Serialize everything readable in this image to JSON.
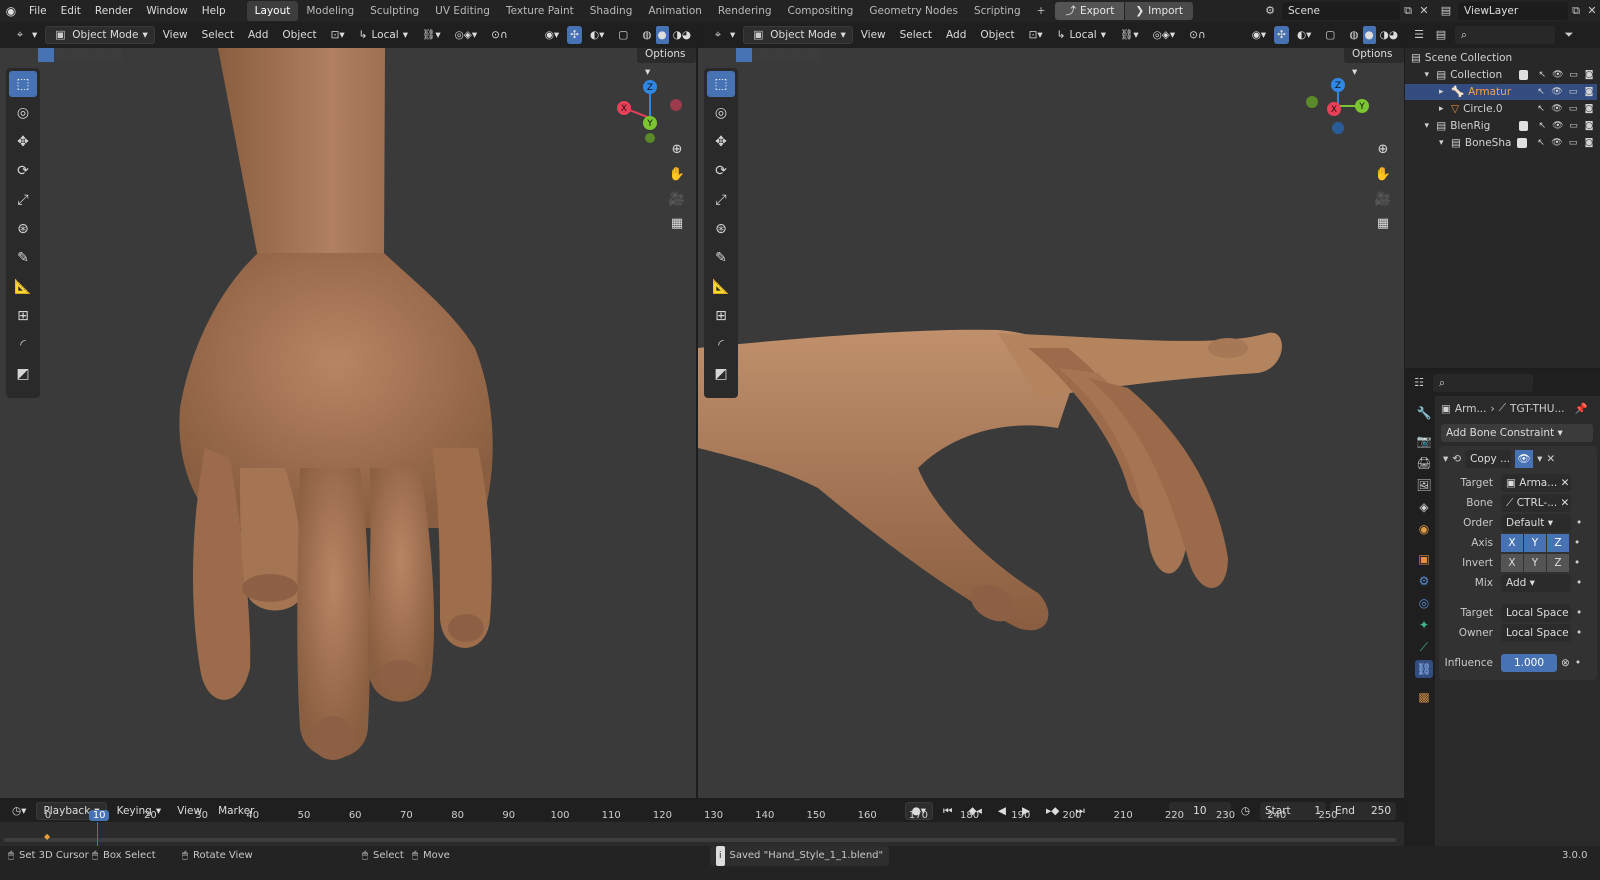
{
  "menu": [
    "File",
    "Edit",
    "Render",
    "Window",
    "Help"
  ],
  "workspaces": [
    "Layout",
    "Modeling",
    "Sculpting",
    "UV Editing",
    "Texture Paint",
    "Shading",
    "Animation",
    "Rendering",
    "Compositing",
    "Geometry Nodes",
    "Scripting"
  ],
  "add_tab": "+",
  "export_label": "Export",
  "import_label": "Import",
  "scene": "Scene",
  "view_layer": "ViewLayer",
  "viewport_header": {
    "mode": "Object Mode",
    "view": "View",
    "select": "Select",
    "add": "Add",
    "object": "Object",
    "pivot": "Local"
  },
  "options_label": "Options",
  "gizmo": {
    "x": "X",
    "y": "Y",
    "z": "Z",
    "x_color": "#e84058",
    "y_color": "#7ac530",
    "z_color": "#2f87e6"
  },
  "outliner": {
    "rows": [
      {
        "label": "Scene Collection",
        "indent": 0,
        "type": "scene"
      },
      {
        "label": "Collection",
        "indent": 1,
        "type": "coll"
      },
      {
        "label": "Armatur",
        "indent": 2,
        "type": "armature",
        "selected": true
      },
      {
        "label": "Circle.0",
        "indent": 2,
        "type": "curve"
      },
      {
        "label": "BlenRig",
        "indent": 1,
        "type": "coll"
      },
      {
        "label": "BoneSha",
        "indent": 2,
        "type": "coll"
      }
    ]
  },
  "properties": {
    "breadcrumb_obj": "Arm...",
    "breadcrumb_bone": "TGT-THU...",
    "add_constraint": "Add Bone Constraint",
    "constraint_name": "Copy ...",
    "target_label": "Target",
    "target_value": "Arma...",
    "bone_label": "Bone",
    "bone_value": "CTRL-...",
    "order_label": "Order",
    "order_value": "Default",
    "axis_label": "Axis",
    "invert_label": "Invert",
    "mix_label": "Mix",
    "mix_value": "Add",
    "target_space_label": "Target",
    "target_space": "Local Space",
    "owner_space_label": "Owner",
    "owner_space": "Local Space",
    "influence_label": "Influence",
    "influence": "1.000",
    "axes": [
      "X",
      "Y",
      "Z"
    ]
  },
  "timeline": {
    "menus": [
      "Playback",
      "Keying",
      "View",
      "Marker"
    ],
    "current_frame": "10",
    "start_label": "Start",
    "start": "1",
    "end_label": "End",
    "end": "250",
    "ticks": [
      "0",
      "10",
      "20",
      "30",
      "40",
      "50",
      "60",
      "70",
      "80",
      "90",
      "100",
      "110",
      "120",
      "130",
      "140",
      "150",
      "160",
      "170",
      "180",
      "190",
      "200",
      "210",
      "220",
      "230",
      "240",
      "250"
    ]
  },
  "status": {
    "set_cursor": "Set 3D Cursor",
    "box_select": "Box Select",
    "rotate_view": "Rotate View",
    "select": "Select",
    "move": "Move",
    "message": "Saved \"Hand_Style_1_1.blend\"",
    "version": "3.0.0"
  },
  "colors": {
    "accent": "#4772b3",
    "skin": "#a67654",
    "viewport_bg": "#3a3a3a"
  }
}
